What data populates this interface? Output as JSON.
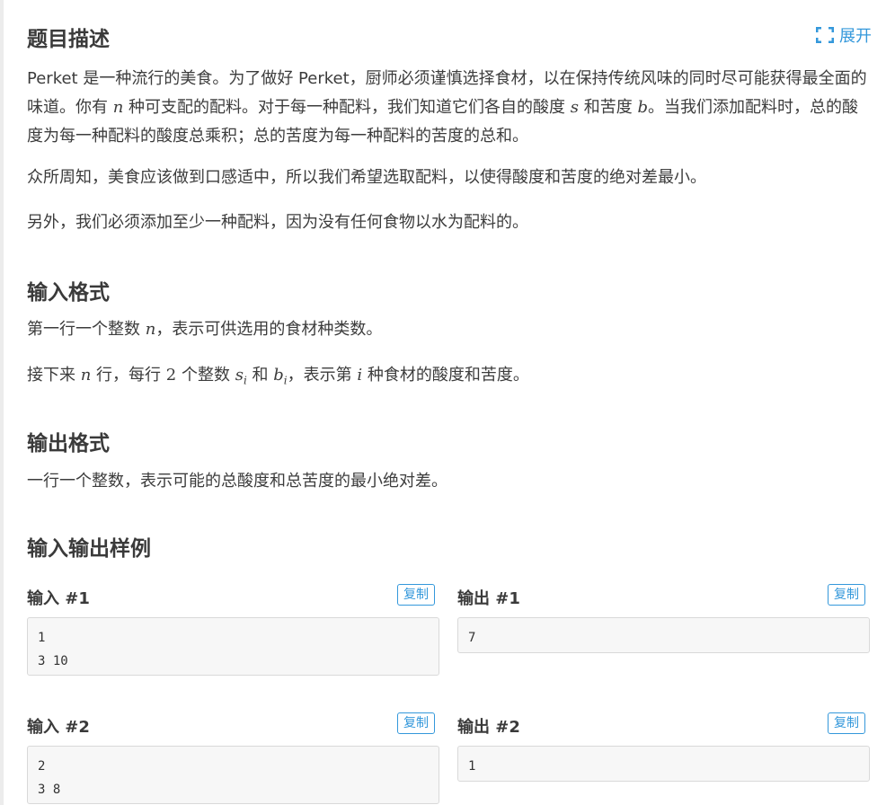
{
  "header": {
    "title": "题目描述",
    "expand_label": "展开",
    "expand_icon": "expand-icon",
    "accent_color": "#3498db"
  },
  "description": {
    "p1_part1": "Perket 是一种流行的美食。为了做好 Perket，厨师必须谨慎选择食材，以在保持传统风味的同时尽可能获得最全面的味道。你有 ",
    "p1_var_n": "n",
    "p1_part2": " 种可支配的配料。对于每一种配料，我们知道它们各自的酸度 ",
    "p1_var_s": "s",
    "p1_part3": " 和苦度 ",
    "p1_var_b": "b",
    "p1_part4": "。当我们添加配料时，总的酸度为每一种配料的酸度总乘积；总的苦度为每一种配料的苦度的总和。",
    "p2": "众所周知，美食应该做到口感适中，所以我们希望选取配料，以使得酸度和苦度的绝对差最小。",
    "p3": "另外，我们必须添加至少一种配料，因为没有任何食物以水为配料的。"
  },
  "input_format": {
    "title": "输入格式",
    "l1_part1": "第一行一个整数 ",
    "l1_var": "n",
    "l1_part2": "，表示可供选用的食材种类数。",
    "l2_part1": "接下来 ",
    "l2_var_n": "n",
    "l2_part2": " 行，每行 ",
    "l2_num": "2",
    "l2_part3": " 个整数 ",
    "l2_var_s": "s",
    "l2_sub_i1": "i",
    "l2_part4": " 和 ",
    "l2_var_b": "b",
    "l2_sub_i2": "i",
    "l2_part5": "，表示第 ",
    "l2_var_i": "i",
    "l2_part6": " 种食材的酸度和苦度。"
  },
  "output_format": {
    "title": "输出格式",
    "text": "一行一个整数，表示可能的总酸度和总苦度的最小绝对差。"
  },
  "samples": {
    "title": "输入输出样例",
    "copy_label": "复制",
    "items": [
      {
        "input_label": "输入 #1",
        "output_label": "输出 #1",
        "input_lines": [
          "1",
          "3 10"
        ],
        "output_lines": [
          "7"
        ]
      },
      {
        "input_label": "输入 #2",
        "output_label": "输出 #2",
        "input_lines": [
          "2",
          "3 8"
        ],
        "output_lines": [
          "1"
        ]
      }
    ]
  }
}
